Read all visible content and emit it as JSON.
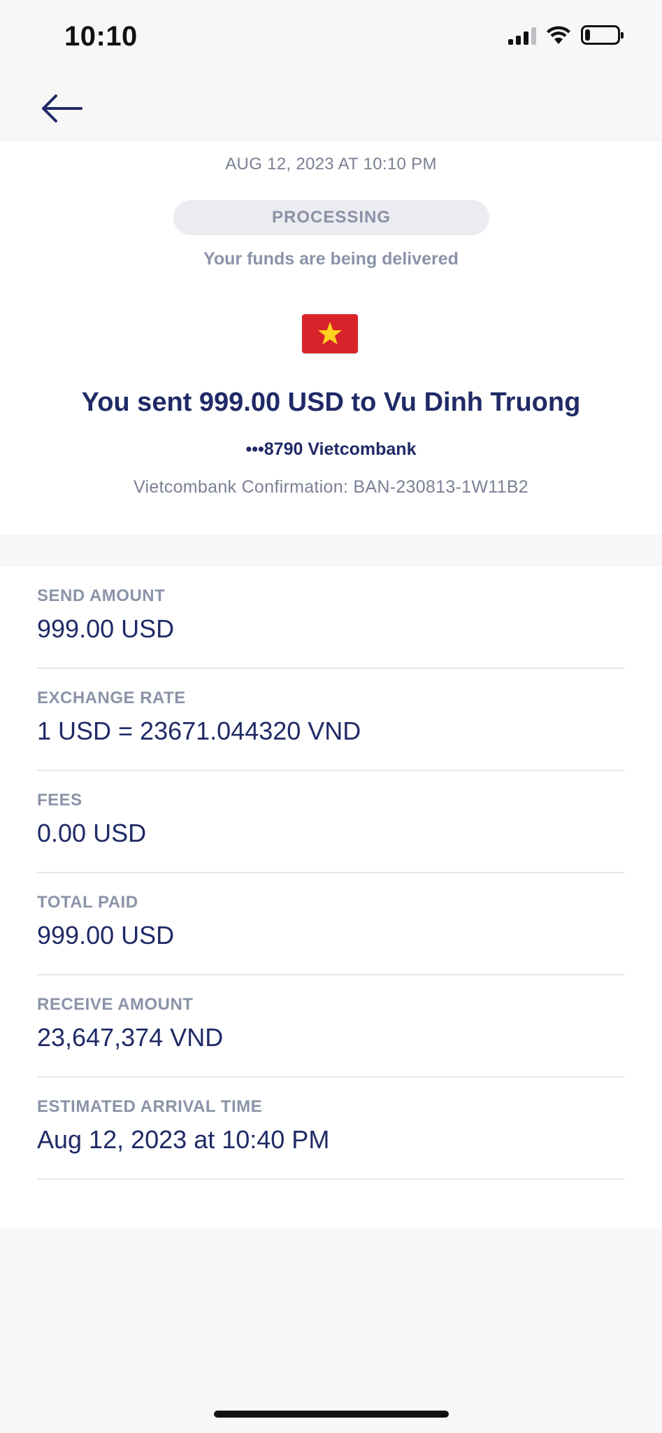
{
  "status_bar": {
    "time": "10:10",
    "icons": [
      "cellular-signal-icon",
      "wifi-icon",
      "battery-icon"
    ],
    "battery_level": 0.15
  },
  "nav": {
    "back_icon": "arrow-left-icon"
  },
  "transfer": {
    "date": "AUG 12, 2023 AT 10:10 PM",
    "status": "PROCESSING",
    "status_message": "Your funds are being delivered",
    "flag_icon": "vietnam-flag-icon",
    "headline": "You sent 999.00 USD to Vu Dinh Truong",
    "account": "•••8790 Vietcombank",
    "confirmation": "Vietcombank Confirmation: BAN-230813-1W11B2"
  },
  "details": [
    {
      "label": "SEND AMOUNT",
      "value": "999.00 USD"
    },
    {
      "label": "EXCHANGE RATE",
      "value": "1 USD = 23671.044320 VND"
    },
    {
      "label": "FEES",
      "value": "0.00 USD"
    },
    {
      "label": "TOTAL PAID",
      "value": "999.00 USD"
    },
    {
      "label": "RECEIVE AMOUNT",
      "value": "23,647,374 VND"
    },
    {
      "label": "ESTIMATED ARRIVAL TIME",
      "value": "Aug 12, 2023 at 10:40 PM"
    }
  ],
  "colors": {
    "primary_text": "#1f2a66",
    "secondary_text": "#8a93a8",
    "pill_background": "#ecebf2",
    "flag_red": "#d9232a",
    "flag_star": "#ffd21f"
  }
}
